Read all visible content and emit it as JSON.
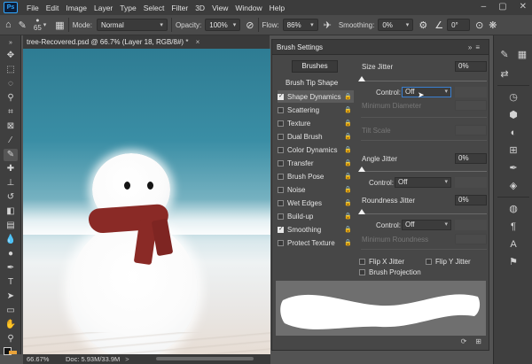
{
  "menu": {
    "logo": "Ps",
    "items": [
      "File",
      "Edit",
      "Image",
      "Layer",
      "Type",
      "Select",
      "Filter",
      "3D",
      "View",
      "Window",
      "Help"
    ]
  },
  "options_bar": {
    "brush_size": "65",
    "mode_label": "Mode:",
    "mode_value": "Normal",
    "opacity_label": "Opacity:",
    "opacity_value": "100%",
    "flow_label": "Flow:",
    "flow_value": "86%",
    "smoothing_label": "Smoothing:",
    "smoothing_value": "0%",
    "angle_value": "0°"
  },
  "document": {
    "tab_title": "tree-Recovered.psd @ 66.7% (Layer 18, RGB/8#) *",
    "close_glyph": "×"
  },
  "status": {
    "zoom": "66.67%",
    "doc_info": "Doc: 5.93M/33.9M",
    "arrow": ">"
  },
  "brush_panel": {
    "title": "Brush Settings",
    "brushes_button": "Brushes",
    "tip_shape": "Brush Tip Shape",
    "options": [
      {
        "label": "Shape Dynamics",
        "checked": true,
        "selected": true
      },
      {
        "label": "Scattering",
        "checked": false
      },
      {
        "label": "Texture",
        "checked": false
      },
      {
        "label": "Dual Brush",
        "checked": false
      },
      {
        "label": "Color Dynamics",
        "checked": false
      },
      {
        "label": "Transfer",
        "checked": false
      },
      {
        "label": "Brush Pose",
        "checked": false
      },
      {
        "label": "Noise",
        "checked": false
      },
      {
        "label": "Wet Edges",
        "checked": false
      },
      {
        "label": "Build-up",
        "checked": false
      },
      {
        "label": "Smoothing",
        "checked": true
      },
      {
        "label": "Protect Texture",
        "checked": false
      }
    ],
    "size_jitter_label": "Size Jitter",
    "size_jitter_value": "0%",
    "control_label": "Control:",
    "control_value_1": "Off",
    "minimum_diameter": "Minimum Diameter",
    "tilt_scale": "Tilt Scale",
    "angle_jitter_label": "Angle Jitter",
    "angle_jitter_value": "0%",
    "control_value_2": "Off",
    "roundness_jitter_label": "Roundness Jitter",
    "roundness_jitter_value": "0%",
    "control_value_3": "Off",
    "minimum_roundness": "Minimum Roundness",
    "flip_x": "Flip X Jitter",
    "flip_y": "Flip Y Jitter",
    "brush_projection": "Brush Projection"
  },
  "colors": {
    "accent_blue": "#3a7fd0",
    "scarf_red": "#8a2a26",
    "panel_bg": "#474747"
  }
}
